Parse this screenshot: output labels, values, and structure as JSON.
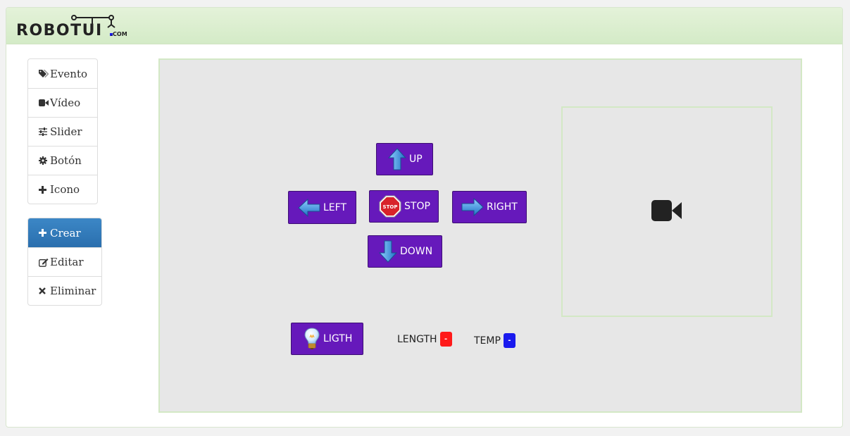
{
  "brand": {
    "name": "ROBOTUI",
    "suffix": ".COM"
  },
  "sidebar": {
    "components": [
      {
        "label": "Evento",
        "icon": "tags-icon"
      },
      {
        "label": "Vídeo",
        "icon": "video-camera-icon"
      },
      {
        "label": "Slider",
        "icon": "sliders-icon"
      },
      {
        "label": "Botón",
        "icon": "gear-icon"
      },
      {
        "label": "Icono",
        "icon": "plus-icon"
      }
    ],
    "actions": [
      {
        "label": "Crear",
        "icon": "plus-icon",
        "active": true
      },
      {
        "label": "Editar",
        "icon": "edit-icon",
        "active": false
      },
      {
        "label": "Eliminar",
        "icon": "close-icon",
        "active": false
      }
    ]
  },
  "controls": {
    "up": "UP",
    "stop": "STOP",
    "stop_sign": "STOP",
    "left": "LEFT",
    "right": "RIGHT",
    "down": "DOWN",
    "light": "LIGTH"
  },
  "readouts": {
    "length": {
      "label": "LENGTH",
      "value": "-",
      "color": "#ff1a1a"
    },
    "temp": {
      "label": "TEMP",
      "value": "-",
      "color": "#1a1aee"
    }
  },
  "video": {
    "icon": "video-camera-icon"
  },
  "colors": {
    "button": "#6619bb",
    "header": "#dcefcf",
    "active": "#337ab7"
  }
}
